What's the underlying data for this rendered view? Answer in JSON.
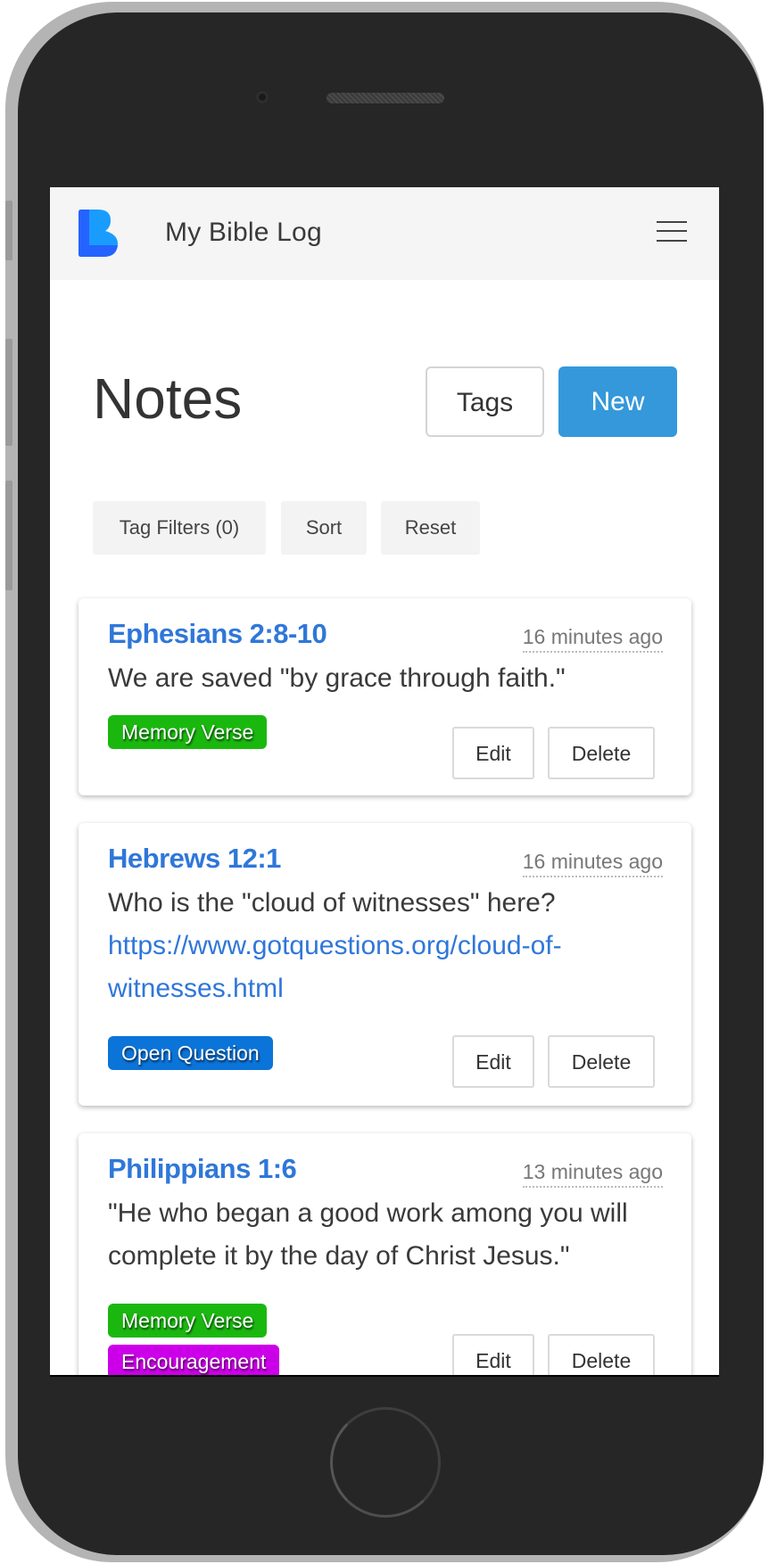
{
  "app": {
    "title": "My Bible Log",
    "logo_icon": "bible-log-b-logo",
    "menu_icon": "hamburger-menu-icon"
  },
  "header": {
    "title": "Notes",
    "tags_button": "Tags",
    "new_button": "New"
  },
  "filters": {
    "tag_filters": "Tag Filters (0)",
    "sort": "Sort",
    "reset": "Reset"
  },
  "colors": {
    "accent": "#3498db",
    "link": "#2f77d9",
    "tag_memory_verse": "#1ab80f",
    "tag_open_question": "#0b74d9",
    "tag_encouragement": "#cc00e8"
  },
  "notes": [
    {
      "reference": "Ephesians 2:8-10",
      "time": "16 minutes ago",
      "text": "We are saved \"by grace through faith.\"",
      "tags": [
        "Memory Verse"
      ],
      "edit": "Edit",
      "delete": "Delete"
    },
    {
      "reference": "Hebrews 12:1",
      "time": "16 minutes ago",
      "text": "Who is the \"cloud of witnesses\" here?",
      "link": "https://www.gotquestions.org/cloud-of-witnesses.html",
      "tags": [
        "Open Question"
      ],
      "edit": "Edit",
      "delete": "Delete"
    },
    {
      "reference": "Philippians 1:6",
      "time": "13 minutes ago",
      "text": "\"He who began a good work among you will complete it by the day of Christ Jesus.\"",
      "tags": [
        "Memory Verse",
        "Encouragement"
      ],
      "edit": "Edit",
      "delete": "Delete"
    }
  ]
}
